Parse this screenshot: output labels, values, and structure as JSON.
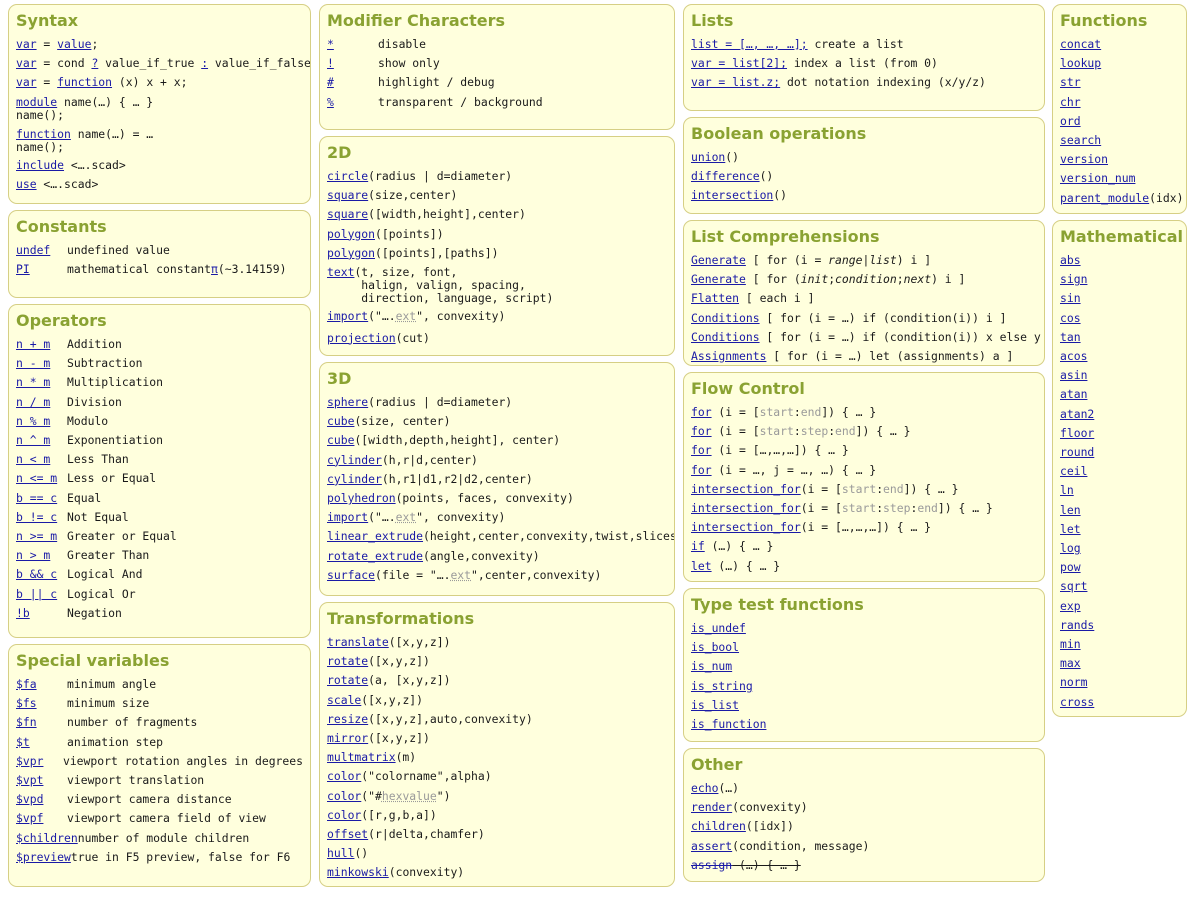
{
  "colors": {
    "panel_bg": "#ffffdd",
    "panel_border": "#d6cf85",
    "heading": "#8aa232",
    "link": "#1a1aa6",
    "muted": "#9a9a9a"
  },
  "syntax": {
    "title": "Syntax",
    "l1": {
      "a": "var",
      "b": " = ",
      "c": "value",
      "d": ";"
    },
    "l2": {
      "a": "var",
      "b": " = cond ",
      "c": "?",
      "d": " value_if_true ",
      "e": ":",
      "f": " value_if_false;"
    },
    "l3": {
      "a": "var",
      "b": " = ",
      "c": "function",
      "d": " (x) x + x;"
    },
    "l4": {
      "a": "module",
      "b": " name(…) { … }",
      "c": "name();"
    },
    "l5": {
      "a": "function",
      "b": " name(…) = …",
      "c": "name();"
    },
    "l6": {
      "a": "include",
      "b": " <….scad>"
    },
    "l7": {
      "a": "use",
      "b": " <….scad>"
    }
  },
  "constants": {
    "title": "Constants",
    "items": [
      {
        "k": "undef",
        "v": "undefined value"
      },
      {
        "k": "PI",
        "v": "mathematical constant ",
        "sym": "π",
        "tail": " (~3.14159)"
      }
    ]
  },
  "operators": {
    "title": "Operators",
    "items": [
      {
        "k": "n + m",
        "v": "Addition"
      },
      {
        "k": "n - m",
        "v": "Subtraction"
      },
      {
        "k": "n * m",
        "v": "Multiplication"
      },
      {
        "k": "n / m",
        "v": "Division"
      },
      {
        "k": "n % m",
        "v": "Modulo"
      },
      {
        "k": "n ^ m",
        "v": "Exponentiation"
      },
      {
        "k": "n < m",
        "v": "Less Than"
      },
      {
        "k": "n <= m",
        "v": "Less or Equal"
      },
      {
        "k": "b == c",
        "v": "Equal"
      },
      {
        "k": "b != c",
        "v": "Not Equal"
      },
      {
        "k": "n >= m",
        "v": "Greater or Equal"
      },
      {
        "k": "n > m",
        "v": "Greater Than"
      },
      {
        "k": "b && c",
        "v": "Logical And"
      },
      {
        "k": "b || c",
        "v": "Logical Or"
      },
      {
        "k": "!b",
        "v": "Negation"
      }
    ]
  },
  "special": {
    "title": "Special variables",
    "items": [
      {
        "k": "$fa",
        "v": "minimum angle"
      },
      {
        "k": "$fs",
        "v": "minimum size"
      },
      {
        "k": "$fn",
        "v": "number of fragments"
      },
      {
        "k": "$t",
        "v": "animation step"
      },
      {
        "k": "$vpr",
        "v": "viewport rotation angles in degrees"
      },
      {
        "k": "$vpt",
        "v": "viewport translation"
      },
      {
        "k": "$vpd",
        "v": "viewport camera distance"
      },
      {
        "k": "$vpf",
        "v": "viewport camera field of view"
      },
      {
        "k": "$children",
        "v": " number of module children"
      },
      {
        "k": "$preview",
        "v": " true in F5 preview, false for F6"
      }
    ]
  },
  "modifiers": {
    "title": "Modifier Characters",
    "items": [
      {
        "k": "*",
        "v": "disable"
      },
      {
        "k": "!",
        "v": "show only"
      },
      {
        "k": "#",
        "v": "highlight / debug"
      },
      {
        "k": "%",
        "v": "transparent / background"
      }
    ]
  },
  "twod": {
    "title": "2D",
    "circle": {
      "a": "circle",
      "b": "(radius | d=diameter)"
    },
    "square1": {
      "a": "square",
      "b": "(size,center)"
    },
    "square2": {
      "a": "square",
      "b": "([width,height],center)"
    },
    "polygon1": {
      "a": "polygon",
      "b": "([points])"
    },
    "polygon2": {
      "a": "polygon",
      "b": "([points],[paths])"
    },
    "text": {
      "a": "text",
      "b": "(t, size, font,\n     halign, valign, spacing,\n     direction, language, script)"
    },
    "import": {
      "a": "import",
      "b": "(\"….",
      "c": "ext",
      "d": "\", convexity)"
    },
    "projection": {
      "a": "projection",
      "b": "(cut)"
    }
  },
  "threed": {
    "title": "3D",
    "items": [
      {
        "a": "sphere",
        "b": "(radius | d=diameter)"
      },
      {
        "a": "cube",
        "b": "(size, center)"
      },
      {
        "a": "cube",
        "b": "([width,depth,height], center)"
      },
      {
        "a": "cylinder",
        "b": "(h,r|d,center)"
      },
      {
        "a": "cylinder",
        "b": "(h,r1|d1,r2|d2,center)"
      },
      {
        "a": "polyhedron",
        "b": "(points, faces, convexity)"
      }
    ],
    "import": {
      "a": "import",
      "b": "(\"….",
      "c": "ext",
      "d": "\", convexity)"
    },
    "items2": [
      {
        "a": "linear_extrude",
        "b": "(height,center,convexity,twist,slices)"
      },
      {
        "a": "rotate_extrude",
        "b": "(angle,convexity)"
      }
    ],
    "surface": {
      "a": "surface",
      "b": "(file = \"….",
      "c": "ext",
      "d": "\",center,convexity)"
    }
  },
  "transforms": {
    "title": "Transformations",
    "items": [
      {
        "a": "translate",
        "b": "([x,y,z])"
      },
      {
        "a": "rotate",
        "b": "([x,y,z])"
      },
      {
        "a": "rotate",
        "b": "(a, [x,y,z])"
      },
      {
        "a": "scale",
        "b": "([x,y,z])"
      },
      {
        "a": "resize",
        "b": "([x,y,z],auto,convexity)"
      },
      {
        "a": "mirror",
        "b": "([x,y,z])"
      },
      {
        "a": "multmatrix",
        "b": "(m)"
      },
      {
        "a": "color",
        "b": "(\"colorname\",alpha)"
      }
    ],
    "colorhex": {
      "a": "color",
      "b": "(\"#",
      "c": "hexvalue",
      "d": "\")"
    },
    "items2": [
      {
        "a": "color",
        "b": "([r,g,b,a])"
      },
      {
        "a": "offset",
        "b": "(r|delta,chamfer)"
      },
      {
        "a": "hull",
        "b": "()"
      },
      {
        "a": "minkowski",
        "b": "(convexity)"
      }
    ]
  },
  "lists": {
    "title": "Lists",
    "items": [
      {
        "a": "list = […, …, …];",
        "b": "  create a list"
      },
      {
        "a": "var = list[2];",
        "b": "  index a list (from 0)"
      },
      {
        "a": "var = list.z;",
        "b": "  dot notation indexing (x/y/z)"
      }
    ]
  },
  "boolean": {
    "title": "Boolean operations",
    "items": [
      {
        "a": "union",
        "b": "()"
      },
      {
        "a": "difference",
        "b": "()"
      },
      {
        "a": "intersection",
        "b": "()"
      }
    ]
  },
  "compr": {
    "title": "List Comprehensions",
    "gen1": {
      "a": "Generate",
      "b": " [ for (i = ",
      "c": "range",
      "d": "|",
      "e": "list",
      "f": ") i ]"
    },
    "gen2": {
      "a": "Generate",
      "b": " [ for (",
      "c": "init",
      "d": ";",
      "e": "condition",
      "f": ";",
      "g": "next",
      "h": ") i ]"
    },
    "items": [
      {
        "a": "Flatten",
        "b": " [ each i ]"
      },
      {
        "a": "Conditions",
        "b": " [ for (i = …) if (condition(i)) i ]"
      },
      {
        "a": "Conditions",
        "b": " [ for (i = …) if (condition(i)) x else y ]"
      },
      {
        "a": "Assignments",
        "b": " [ for (i = …) let (assignments) a ]"
      }
    ]
  },
  "flow": {
    "title": "Flow Control",
    "for1": {
      "a": "for",
      "b": " (i = [",
      "c": "start",
      "d": ":",
      "e": "end",
      "f": "]) { … }"
    },
    "for2": {
      "a": "for",
      "b": " (i = [",
      "c": "start",
      "d": ":",
      "e": "step",
      "f": ":",
      "g": "end",
      "h": "]) { … }"
    },
    "for3": {
      "a": "for",
      "b": " (i = […,…,…]) { … }"
    },
    "for4": {
      "a": "for",
      "b": " (i = …, j = …, …) { … }"
    },
    "if1": {
      "a": "intersection_for",
      "b": "(i = [",
      "c": "start",
      "d": ":",
      "e": "end",
      "f": "]) { … }"
    },
    "if2": {
      "a": "intersection_for",
      "b": "(i = [",
      "c": "start",
      "d": ":",
      "e": "step",
      "f": ":",
      "g": "end",
      "h": "]) { … }"
    },
    "if3": {
      "a": "intersection_for",
      "b": "(i = […,…,…]) { … }"
    },
    "iff": {
      "a": "if",
      "b": " (…) { … }"
    },
    "let": {
      "a": "let",
      "b": " (…) { … }"
    }
  },
  "typetest": {
    "title": "Type test functions",
    "items": [
      "is_undef",
      "is_bool",
      "is_num",
      "is_string",
      "is_list",
      "is_function"
    ]
  },
  "other": {
    "title": "Other",
    "items": [
      {
        "a": "echo",
        "b": "(…)"
      },
      {
        "a": "render",
        "b": "(convexity)"
      },
      {
        "a": "children",
        "b": "([idx])"
      },
      {
        "a": "assert",
        "b": "(condition, message)"
      }
    ],
    "assign": {
      "a": "assign",
      "b": " (…) { … }"
    }
  },
  "functions": {
    "title": "Functions",
    "items": [
      "concat",
      "lookup",
      "str",
      "chr",
      "ord",
      "search",
      "version",
      "version_num"
    ],
    "parent": {
      "a": "parent_module",
      "b": "(idx)"
    }
  },
  "math": {
    "title": "Mathematical",
    "items": [
      "abs",
      "sign",
      "sin",
      "cos",
      "tan",
      "acos",
      "asin",
      "atan",
      "atan2",
      "floor",
      "round",
      "ceil",
      "ln",
      "len",
      "let",
      "log",
      "pow",
      "sqrt",
      "exp",
      "rands",
      "min",
      "max",
      "norm",
      "cross"
    ]
  }
}
